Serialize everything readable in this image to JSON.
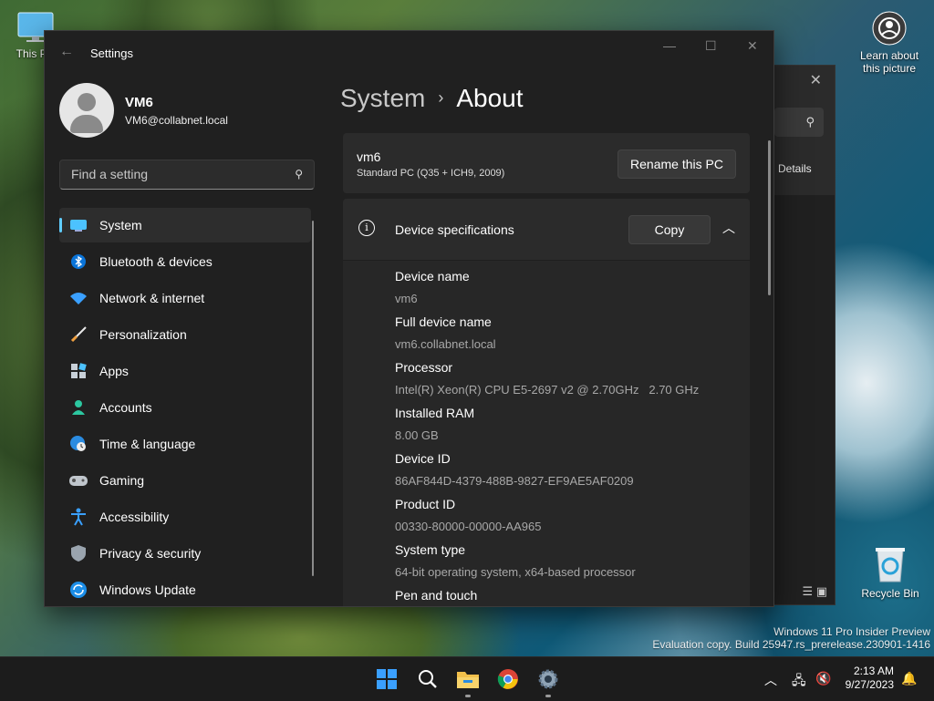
{
  "desktop": {
    "icons": [
      {
        "label": "This PC"
      },
      {
        "label": "Learn about this picture"
      },
      {
        "label": "Recycle Bin"
      }
    ],
    "watermark": {
      "line1": "Windows 11 Pro Insider Preview",
      "line2": "Evaluation copy. Build 25947.rs_prerelease.230901-1416"
    }
  },
  "background_window": {
    "details_label": "Details"
  },
  "settings": {
    "window_title": "Settings",
    "user": {
      "name": "VM6",
      "email": "VM6@collabnet.local"
    },
    "search": {
      "placeholder": "Find a setting"
    },
    "nav": [
      {
        "label": "System",
        "icon": "monitor-icon",
        "active": true
      },
      {
        "label": "Bluetooth & devices",
        "icon": "bluetooth-icon"
      },
      {
        "label": "Network & internet",
        "icon": "wifi-icon"
      },
      {
        "label": "Personalization",
        "icon": "brush-icon"
      },
      {
        "label": "Apps",
        "icon": "apps-icon"
      },
      {
        "label": "Accounts",
        "icon": "person-icon"
      },
      {
        "label": "Time & language",
        "icon": "globe-clock-icon"
      },
      {
        "label": "Gaming",
        "icon": "gamepad-icon"
      },
      {
        "label": "Accessibility",
        "icon": "accessibility-icon"
      },
      {
        "label": "Privacy & security",
        "icon": "shield-icon"
      },
      {
        "label": "Windows Update",
        "icon": "update-icon"
      }
    ],
    "breadcrumb": {
      "parent": "System",
      "separator": "›",
      "current": "About"
    },
    "pc": {
      "name": "vm6",
      "model": "Standard PC (Q35 + ICH9, 2009)",
      "rename_label": "Rename this PC"
    },
    "device_specs": {
      "title": "Device specifications",
      "copy_label": "Copy",
      "rows": [
        {
          "key": "Device name",
          "value": "vm6"
        },
        {
          "key": "Full device name",
          "value": "vm6.collabnet.local"
        },
        {
          "key": "Processor",
          "value": "Intel(R) Xeon(R) CPU E5-2697 v2 @ 2.70GHz   2.70 GHz"
        },
        {
          "key": "Installed RAM",
          "value": "8.00 GB"
        },
        {
          "key": "Device ID",
          "value": "86AF844D-4379-488B-9827-EF9AE5AF0209"
        },
        {
          "key": "Product ID",
          "value": "00330-80000-00000-AA965"
        },
        {
          "key": "System type",
          "value": "64-bit operating system, x64-based processor"
        },
        {
          "key": "Pen and touch",
          "value": ""
        }
      ]
    }
  },
  "taskbar": {
    "apps": [
      "start-icon",
      "search-icon",
      "file-explorer-icon",
      "chrome-icon",
      "settings-icon"
    ],
    "clock": {
      "time": "2:13 AM",
      "date": "9/27/2023"
    }
  },
  "colors": {
    "accent": "#60cdff",
    "window_bg": "#202020",
    "card_bg": "#2b2b2b"
  }
}
